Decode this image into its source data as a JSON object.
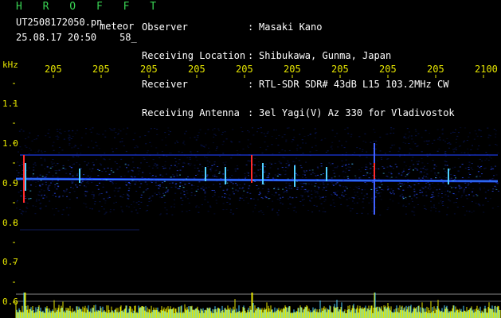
{
  "header": {
    "title": "H R O F F T",
    "filename": "UT2508172050.pn",
    "mode": "meteor",
    "datetime": "25.08.17 20:50",
    "frame": "58_"
  },
  "info": [
    {
      "label": "Observer",
      "value": "Masaki Kano"
    },
    {
      "label": "Receiving Location",
      "value": "Shibukawa, Gunma, Japan"
    },
    {
      "label": "Receiver",
      "value": "RTL-SDR SDR# 43dB L15 103.2MHz CW"
    },
    {
      "label": "Receiving Antenna",
      "value": "3el Yagi(V) Az 330 for Vladivostok"
    }
  ],
  "separator": ":",
  "axis": {
    "unit": "kHz",
    "y_ticks": [
      "1.1",
      "1.0",
      "0.9",
      "0.8",
      "0.7",
      "0.6"
    ],
    "x_ticks": [
      "205",
      "205",
      "205",
      "205",
      "205",
      "205",
      "205",
      "205",
      "205",
      "2100"
    ]
  },
  "colors": {
    "background": "#000000",
    "text_green": "#39d353",
    "text_yellow": "#e6e600",
    "signal_blue": "#1f3cff",
    "signal_cyan": "#4fd0ff",
    "signal_red": "#ff2a2a"
  }
}
